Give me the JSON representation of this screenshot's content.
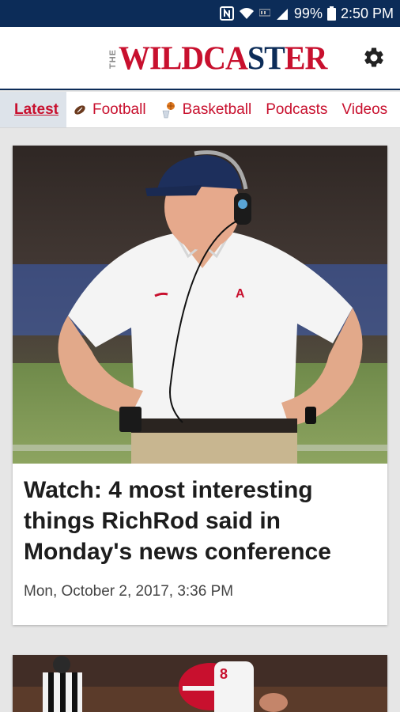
{
  "status_bar": {
    "battery": "99%",
    "time": "2:50 PM",
    "icons": [
      "nfc-icon",
      "wifi-icon",
      "hd-icon",
      "signal-icon",
      "battery-icon"
    ]
  },
  "header": {
    "logo_the": "THE",
    "logo_word_a": "WILDCA",
    "logo_word_b": "ST",
    "logo_word_c": "ER",
    "settings_icon": "gear-icon"
  },
  "tabs": [
    {
      "label": "Latest",
      "active": true
    },
    {
      "label": "Football",
      "icon": "football-icon"
    },
    {
      "label": "Basketball",
      "icon": "basketball-icon"
    },
    {
      "label": "Podcasts"
    },
    {
      "label": "Videos"
    }
  ],
  "articles": [
    {
      "headline": "Watch: 4 most interesting things RichRod said in Monday's news conference",
      "date": "Mon, October 2, 2017, 3:36 PM"
    }
  ],
  "colors": {
    "brand_navy": "#0c2c58",
    "brand_red": "#c8102e",
    "tab_active_bg": "#dde3ea",
    "page_bg": "#e6e6e6"
  }
}
